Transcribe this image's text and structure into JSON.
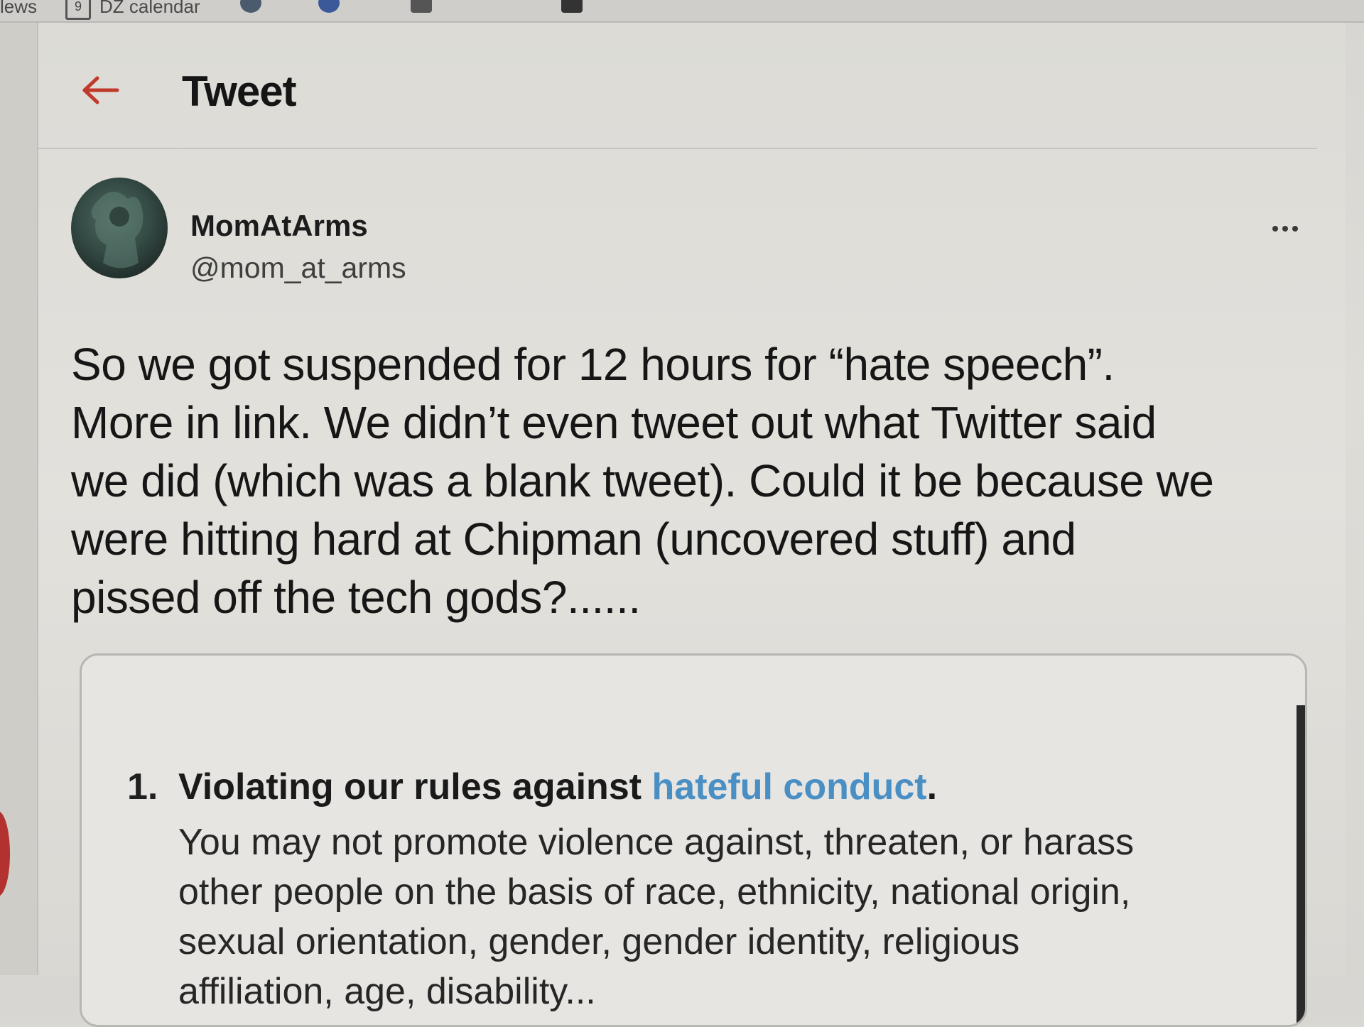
{
  "browser": {
    "bookmarks": [
      {
        "label": "lews"
      },
      {
        "label": "DZ calendar"
      }
    ]
  },
  "header": {
    "title": "Tweet"
  },
  "tweet": {
    "author_name": "MomAtArms",
    "author_handle": "@mom_at_arms",
    "text_lines": [
      "So we got suspended for 12 hours for “hate speech”.",
      "More in link. We didn’t even tweet out what Twitter said",
      "we did (which was a blank tweet). Could it be because we",
      "were hitting hard at Chipman (uncovered stuff) and",
      "pissed off the tech gods?......"
    ]
  },
  "embedded": {
    "rule_number": "1.",
    "rule_heading_prefix": "Violating our rules against ",
    "rule_link": "hateful conduct",
    "rule_heading_suffix": ".",
    "rule_body_lines": [
      "You may not promote violence against, threaten, or harass",
      "other people on the basis of race, ethnicity, national origin,",
      "sexual orientation, gender, gender identity, religious",
      "affiliation, age, disability..."
    ]
  },
  "icons": {
    "back": "back-arrow-icon",
    "more": "more-options-icon",
    "accent_color": "#c0392b",
    "link_color": "#4a8fc4"
  }
}
